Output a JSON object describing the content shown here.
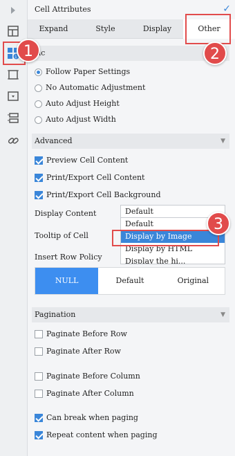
{
  "panel": {
    "title": "Cell Attributes",
    "tabs": [
      "Expand",
      "Style",
      "Display",
      "Other"
    ],
    "active_tab": "Other"
  },
  "basic": {
    "header": "sic",
    "options": [
      {
        "label": "Follow Paper Settings",
        "selected": true
      },
      {
        "label": "No Automatic Adjustment",
        "selected": false
      },
      {
        "label": "Auto Adjust Height",
        "selected": false
      },
      {
        "label": "Auto Adjust Width",
        "selected": false
      }
    ]
  },
  "advanced": {
    "header": "Advanced",
    "checks": [
      {
        "label": "Preview Cell Content",
        "checked": true
      },
      {
        "label": "Print/Export Cell Content",
        "checked": true
      },
      {
        "label": "Print/Export Cell Background",
        "checked": true
      }
    ],
    "display_content_label": "Display Content",
    "tooltip_label": "Tooltip of Cell",
    "insert_row_label": "Insert Row Policy",
    "dropdown": {
      "selected": "Default",
      "options": [
        "Default",
        "Display by Image",
        "Display by HTML",
        "Display the hi..."
      ],
      "highlighted": "Display by Image"
    },
    "insert_row_options": [
      "NULL",
      "Default",
      "Original"
    ],
    "insert_row_selected": "NULL"
  },
  "pagination": {
    "header": "Pagination",
    "group1": [
      {
        "label": "Paginate Before Row",
        "checked": false
      },
      {
        "label": "Paginate After Row",
        "checked": false
      }
    ],
    "group2": [
      {
        "label": "Paginate Before Column",
        "checked": false
      },
      {
        "label": "Paginate After Column",
        "checked": false
      }
    ],
    "group3": [
      {
        "label": "Can break when paging",
        "checked": true
      },
      {
        "label": "Repeat content when paging",
        "checked": true
      }
    ]
  },
  "annotations": [
    "1",
    "2",
    "3"
  ],
  "colors": {
    "accent": "#3a86d9",
    "marker": "#e14b4b",
    "segment_active": "#3d8ef0"
  }
}
